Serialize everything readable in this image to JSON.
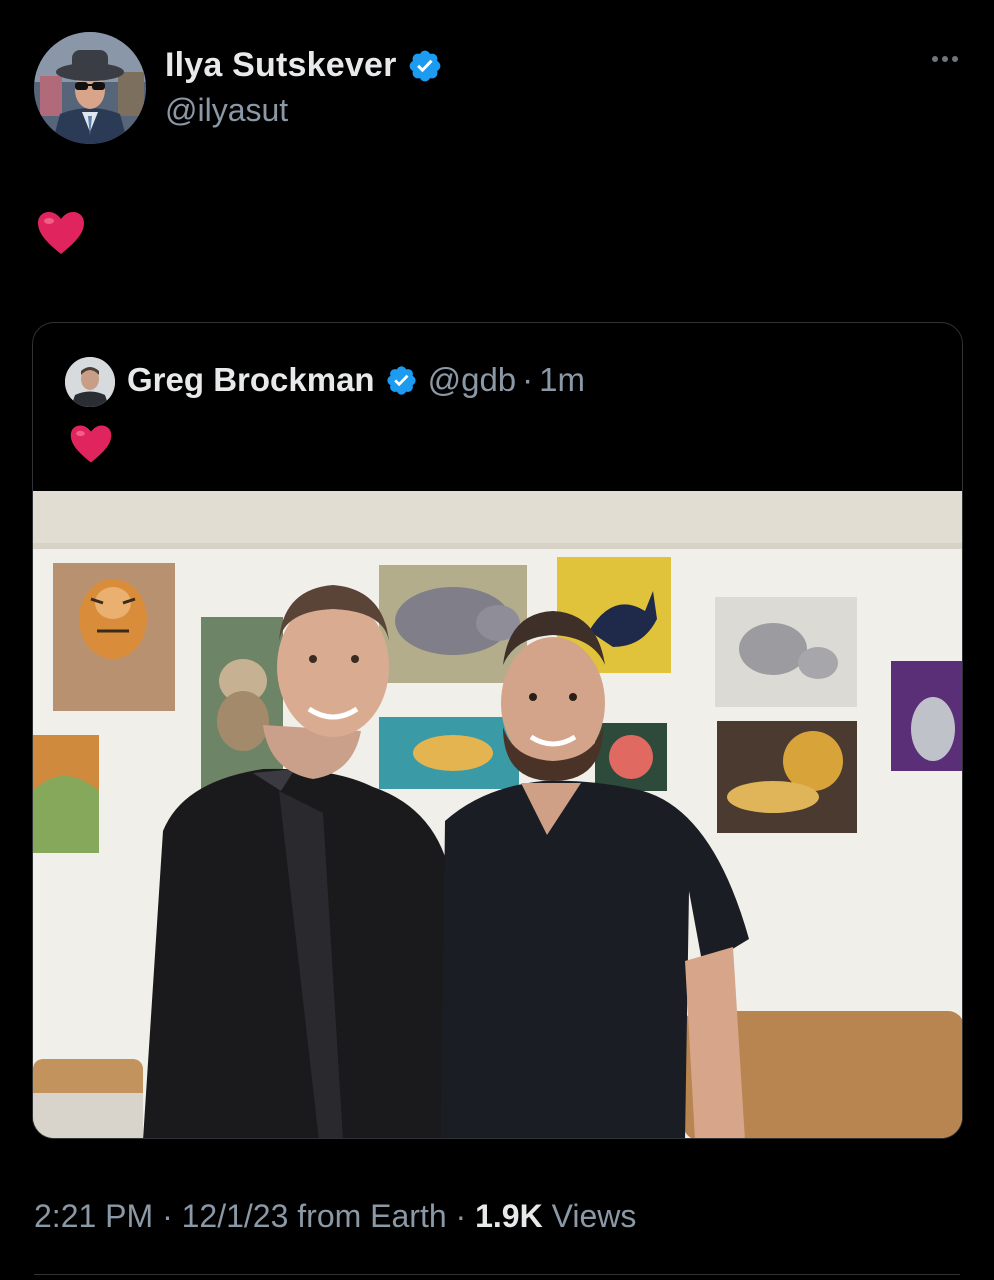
{
  "author": {
    "display_name": "Ilya Sutskever",
    "handle": "@ilyasut",
    "verified_icon": "verified-badge-icon"
  },
  "tweet": {
    "text_icon": "red-heart-icon"
  },
  "quoted_tweet": {
    "display_name": "Greg Brockman",
    "handle": "@gdb",
    "separator": "·",
    "time": "1m",
    "text_icon": "red-heart-icon"
  },
  "meta": {
    "time": "2:21 PM",
    "separator": "·",
    "date": "12/1/23 from Earth",
    "separator2": "·",
    "views_count": "1.9K",
    "views_label": "Views"
  },
  "colors": {
    "background": "#000000",
    "text_primary": "#e7e9ea",
    "text_secondary": "#8b98a5",
    "verified_blue": "#1d9bf0",
    "heart_red": "#e0245e",
    "border": "#2f3336"
  }
}
